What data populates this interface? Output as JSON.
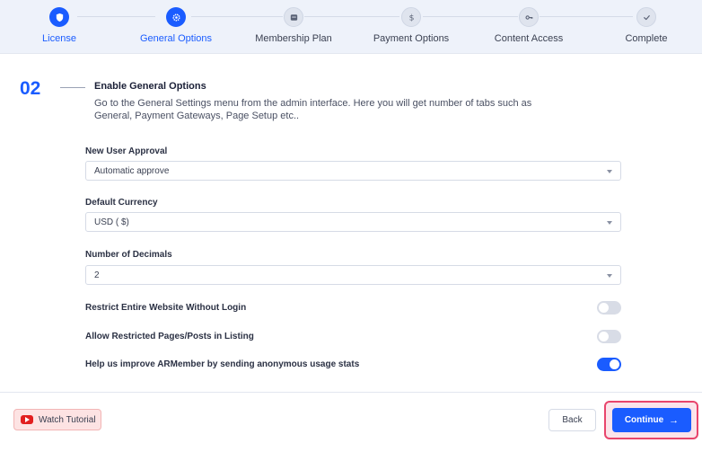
{
  "stepper": {
    "steps": [
      {
        "label": "License",
        "icon": "shield-icon",
        "state": "active"
      },
      {
        "label": "General Options",
        "icon": "gear-icon",
        "state": "active"
      },
      {
        "label": "Membership Plan",
        "icon": "plan-icon",
        "state": "inactive"
      },
      {
        "label": "Payment Options",
        "icon": "dollar-icon",
        "state": "inactive"
      },
      {
        "label": "Content Access",
        "icon": "key-icon",
        "state": "inactive"
      },
      {
        "label": "Complete",
        "icon": "check-icon",
        "state": "inactive"
      }
    ]
  },
  "section": {
    "number": "02",
    "title": "Enable General Options",
    "description": "Go to the General Settings menu from the admin interface. Here you will get number of tabs such as General, Payment Gateways, Page Setup etc.."
  },
  "fields": {
    "new_user_approval": {
      "label": "New User Approval",
      "value": "Automatic approve"
    },
    "default_currency": {
      "label": "Default Currency",
      "value": "USD ( $)"
    },
    "number_of_decimals": {
      "label": "Number of Decimals",
      "value": "2"
    }
  },
  "toggles": {
    "restrict_website": {
      "label": "Restrict Entire Website Without Login",
      "on": false
    },
    "allow_restricted": {
      "label": "Allow Restricted Pages/Posts in Listing",
      "on": false
    },
    "usage_stats": {
      "label": "Help us improve ARMember by sending anonymous usage stats",
      "on": true
    }
  },
  "footer": {
    "watch_tutorial_label": "Watch Tutorial",
    "back_label": "Back",
    "continue_label": "Continue",
    "continue_arrow": "→"
  },
  "colors": {
    "accent": "#1a5cff",
    "highlight": "#e8456c",
    "youtube": "#e21f1f"
  }
}
